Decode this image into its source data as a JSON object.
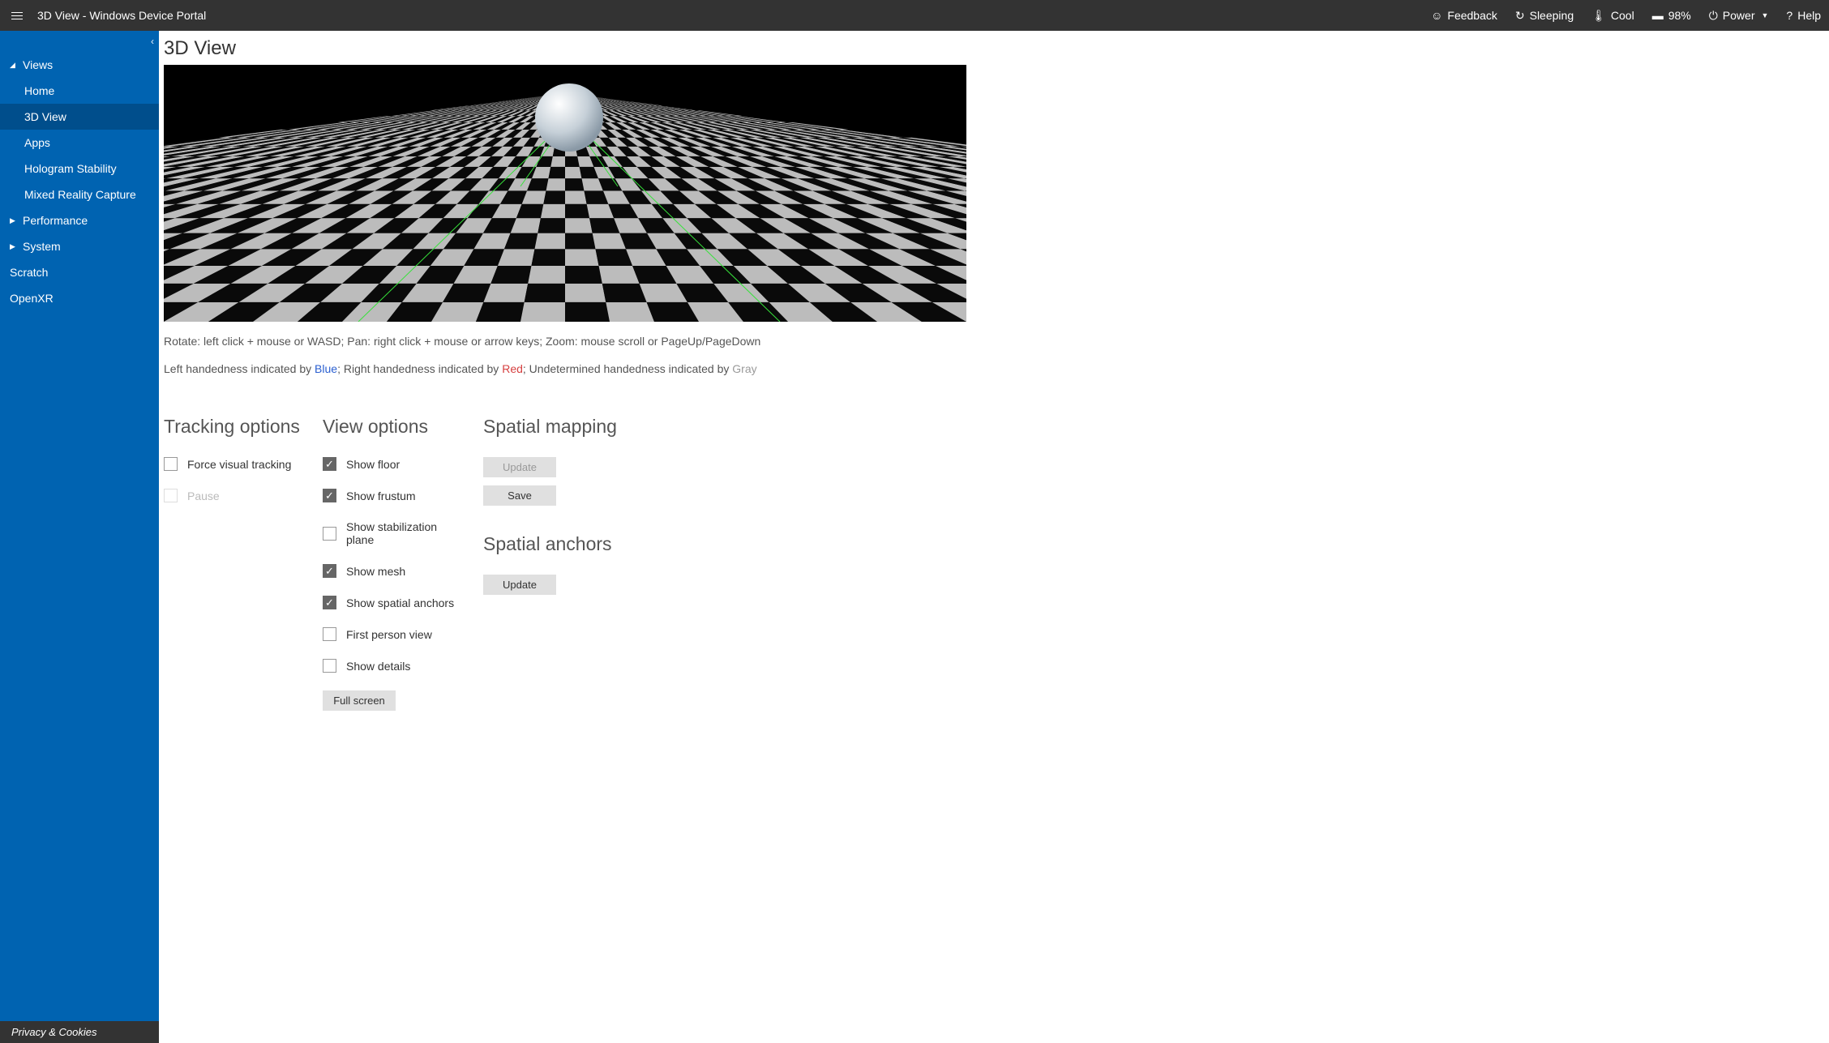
{
  "titlebar": {
    "title": "3D View - Windows Device Portal",
    "feedback": "Feedback",
    "sleeping": "Sleeping",
    "cool": "Cool",
    "battery": "98%",
    "power": "Power",
    "help": "Help"
  },
  "sidebar": {
    "groups": {
      "views": "Views",
      "performance": "Performance",
      "system": "System"
    },
    "items": {
      "home": "Home",
      "view3d": "3D View",
      "apps": "Apps",
      "holo": "Hologram Stability",
      "mrc": "Mixed Reality Capture",
      "scratch": "Scratch",
      "openxr": "OpenXR"
    },
    "privacy": "Privacy & Cookies"
  },
  "page": {
    "title": "3D View",
    "instructions": "Rotate: left click + mouse or WASD; Pan: right click + mouse or arrow keys; Zoom: mouse scroll or PageUp/PageDown",
    "hand_pre_left": "Left handedness indicated by ",
    "hand_blue": "Blue",
    "hand_sep1": "; Right handedness indicated by ",
    "hand_red": "Red",
    "hand_sep2": "; Undetermined handedness indicated by ",
    "hand_gray": "Gray"
  },
  "tracking": {
    "title": "Tracking options",
    "force": "Force visual tracking",
    "pause": "Pause"
  },
  "view": {
    "title": "View options",
    "floor": "Show floor",
    "frustum": "Show frustum",
    "stab": "Show stabilization plane",
    "mesh": "Show mesh",
    "anchors": "Show spatial anchors",
    "fpv": "First person view",
    "details": "Show details",
    "fullscreen": "Full screen"
  },
  "spatial": {
    "mapping_title": "Spatial mapping",
    "update": "Update",
    "save": "Save",
    "anchors_title": "Spatial anchors",
    "anchors_update": "Update"
  }
}
